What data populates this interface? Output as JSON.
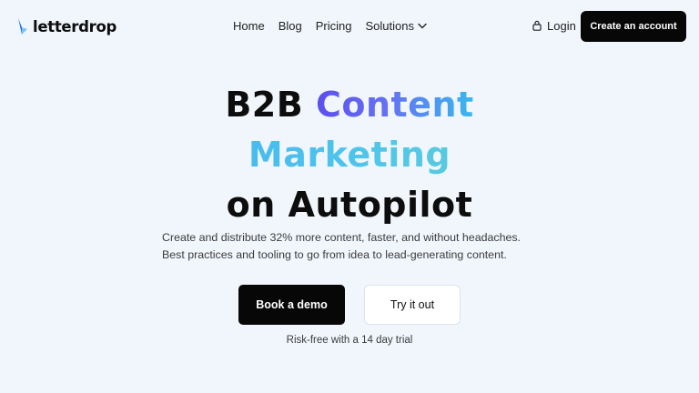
{
  "brand": {
    "name": "letterdrop",
    "logo_icon": "letterdrop-logo-icon",
    "logo_colors": [
      "#1f6fe0",
      "#7dc7f2"
    ]
  },
  "nav": {
    "items": [
      {
        "label": "Home"
      },
      {
        "label": "Blog"
      },
      {
        "label": "Pricing"
      }
    ],
    "solutions_label": "Solutions",
    "solutions_icon": "chevron-down-icon"
  },
  "auth": {
    "login_label": "Login",
    "login_icon": "lock-icon",
    "create_account_label": "Create an account"
  },
  "hero": {
    "title_part1": "B2B",
    "title_part2": "Content",
    "title_part3": "Marketing",
    "title_part4": "on Autopilot",
    "subtitle": "Create and distribute 32% more content, faster, and without headaches. Best practices and tooling to go from idea to lead-generating content.",
    "primary_cta": "Book a demo",
    "secondary_cta": "Try it out",
    "trial_note": "Risk-free with a 14 day trial"
  },
  "colors": {
    "background": "#f1f6fc",
    "dark_button": "#070707",
    "gradient_content": [
      "#5a4ff0",
      "#38b9ee"
    ],
    "gradient_marketing": [
      "#3ba7f2",
      "#6fd9c4"
    ]
  }
}
